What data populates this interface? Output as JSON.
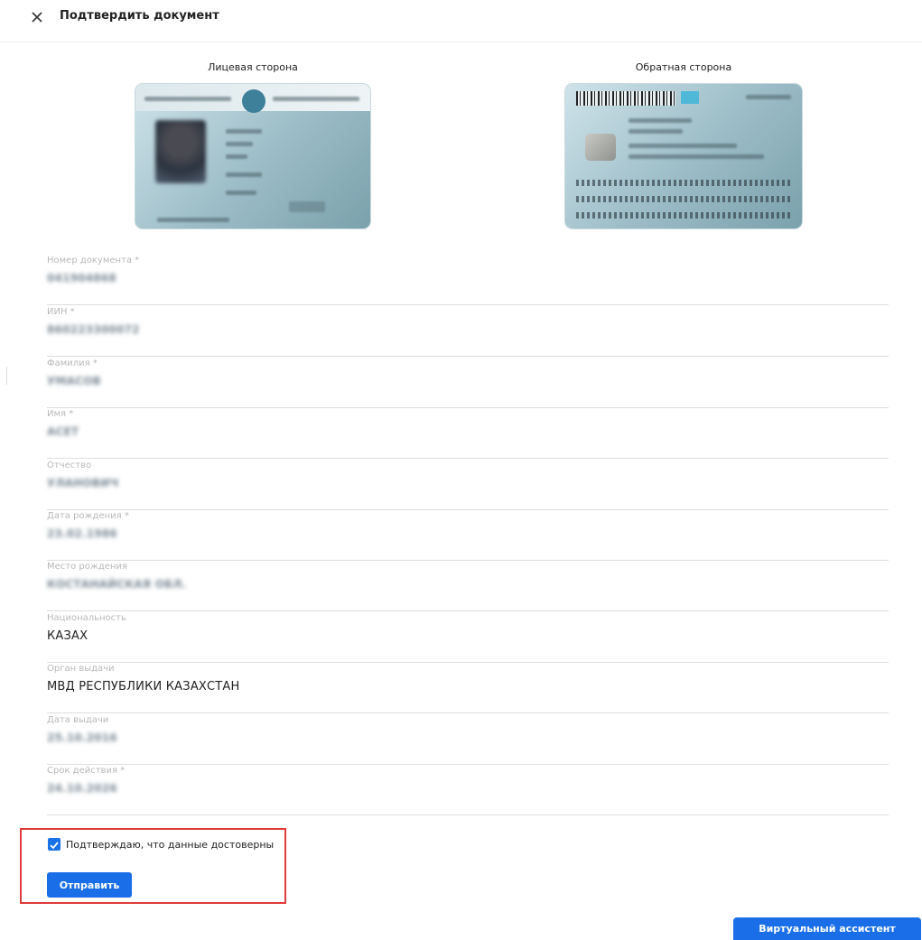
{
  "header": {
    "close_icon": "close-icon",
    "title": "Подтвердить документ"
  },
  "documents": {
    "front_label": "Лицевая сторона",
    "back_label": "Обратная сторона"
  },
  "fields": [
    {
      "label": "Номер документа *",
      "value": "041904868"
    },
    {
      "label": "ИИН *",
      "value": "860223300072"
    },
    {
      "label": "Фамилия *",
      "value": "УМАСОВ"
    },
    {
      "label": "Имя *",
      "value": "АСЕТ"
    },
    {
      "label": "Отчество",
      "value": "УЛАНОВИЧ"
    },
    {
      "label": "Дата рождения *",
      "value": "23.02.1986"
    },
    {
      "label": "Место рождения",
      "value": "КОСТАНАЙСКАЯ ОБЛ."
    },
    {
      "label": "Национальность",
      "value": "КАЗАХ"
    },
    {
      "label": "Орган выдачи",
      "value": "МВД РЕСПУБЛИКИ КАЗАХСТАН"
    },
    {
      "label": "Дата выдачи",
      "value": "25.10.2016"
    },
    {
      "label": "Срок действия *",
      "value": "24.10.2026"
    }
  ],
  "confirm": {
    "checked": true,
    "label": "Подтверждаю, что данные достоверны",
    "submit_label": "Отправить"
  },
  "assistant": {
    "label": "Виртуальный ассистент"
  },
  "colors": {
    "accent": "#1a6fe8",
    "highlight_border": "#e03a3a"
  }
}
